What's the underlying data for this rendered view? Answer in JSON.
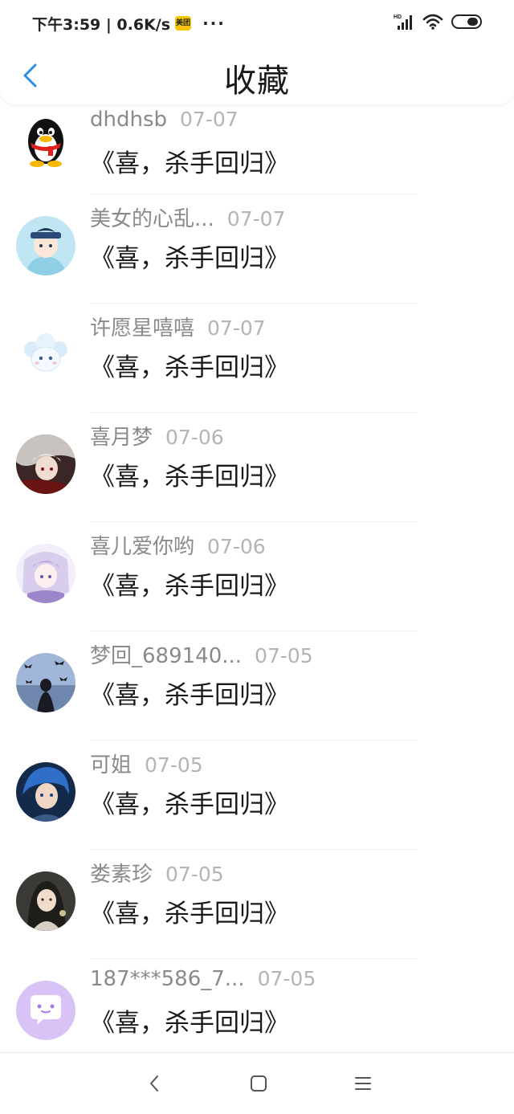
{
  "status_bar": {
    "time_speed": "下午3:59 | 0.6K/s",
    "app_badge": "美团",
    "more_dots": "···",
    "network_label": "HD"
  },
  "header": {
    "title": "收藏"
  },
  "favorites": [
    {
      "username": "dhdhsb",
      "date": "07-07",
      "title": "《喜，杀手回归》",
      "avatar": "qq-penguin"
    },
    {
      "username": "美女的心乱...",
      "date": "07-07",
      "title": "《喜，杀手回归》",
      "avatar": "anime-police-boy"
    },
    {
      "username": "许愿星嘻嘻",
      "date": "07-07",
      "title": "《喜，杀手回归》",
      "avatar": "cloud-sheep"
    },
    {
      "username": "喜月梦",
      "date": "07-06",
      "title": "《喜，杀手回归》",
      "avatar": "dark-anime-girl"
    },
    {
      "username": "喜儿爱你哟",
      "date": "07-06",
      "title": "《喜，杀手回归》",
      "avatar": "purple-anime-girl"
    },
    {
      "username": "梦回_689140...",
      "date": "07-05",
      "title": "《喜，杀手回归》",
      "avatar": "bats-silhouette"
    },
    {
      "username": "可姐",
      "date": "07-05",
      "title": "《喜，杀手回归》",
      "avatar": "blue-hair-hero"
    },
    {
      "username": "娄素珍",
      "date": "07-05",
      "title": "《喜，杀手回归》",
      "avatar": "ancient-lady"
    },
    {
      "username": "187***586_7...",
      "date": "07-05",
      "title": "《喜，杀手回归》",
      "avatar": "purple-chat-bubble"
    }
  ],
  "colors": {
    "accent": "#2a8de8",
    "username": "#8a8a8a",
    "date": "#b4b4b4",
    "title": "#1a1a1a"
  }
}
